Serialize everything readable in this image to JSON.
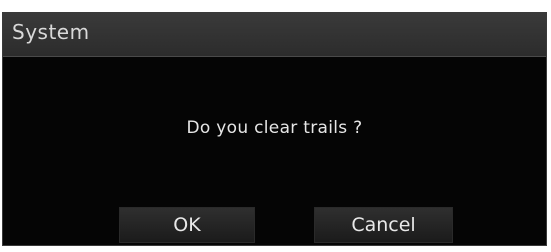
{
  "dialog": {
    "title": "System",
    "message": "Do you clear trails ?",
    "ok_label": "OK",
    "cancel_label": "Cancel"
  },
  "colors": {
    "background": "#050505",
    "titlebar": "#333333",
    "text": "#e6e6e6",
    "button": "#252525"
  }
}
